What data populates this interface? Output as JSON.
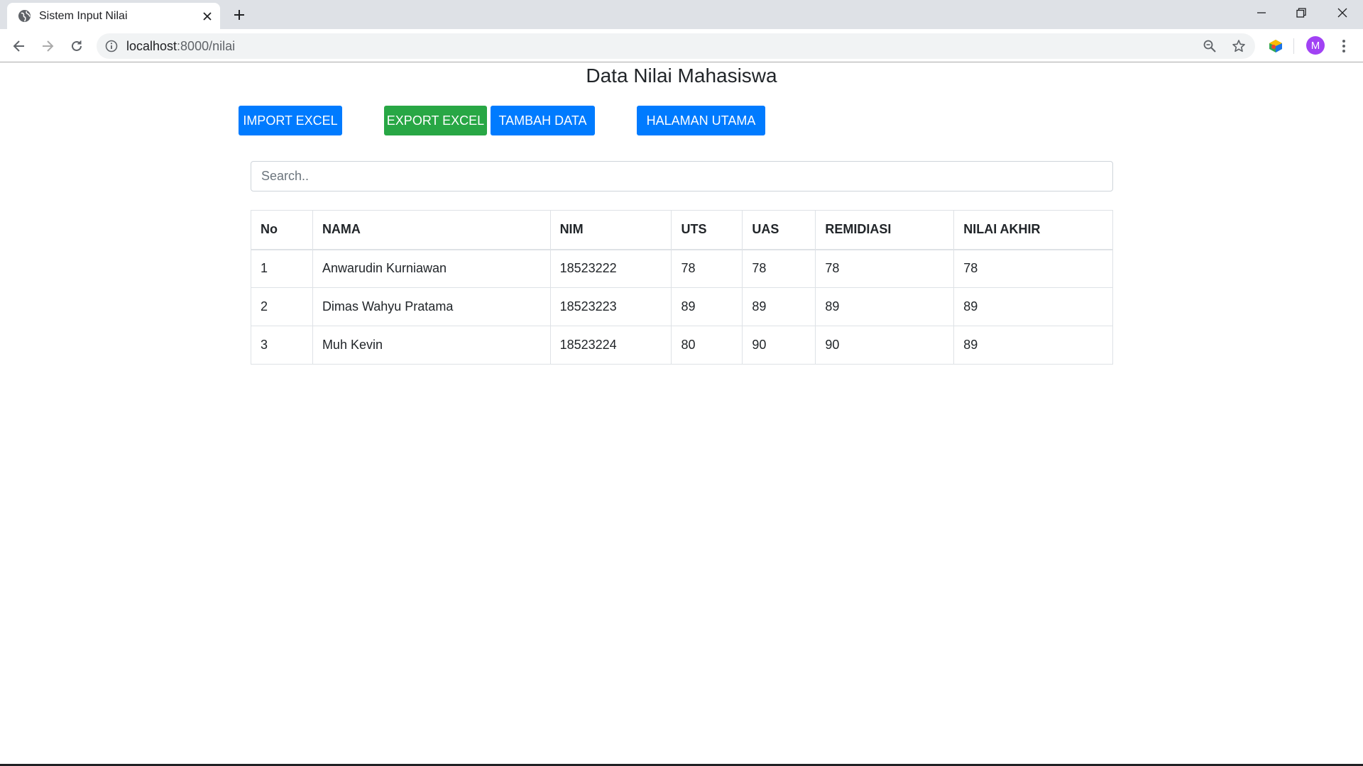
{
  "browser": {
    "tab_title": "Sistem Input Nilai",
    "url_host": "localhost",
    "url_path": ":8000/nilai",
    "profile_initial": "M"
  },
  "page": {
    "title": "Data Nilai Mahasiswa",
    "buttons": {
      "import": "IMPORT EXCEL",
      "export": "EXPORT EXCEL",
      "add": "TAMBAH DATA",
      "home": "HALAMAN UTAMA"
    },
    "search_placeholder": "Search..",
    "table": {
      "headers": [
        "No",
        "NAMA",
        "NIM",
        "UTS",
        "UAS",
        "REMIDIASI",
        "NILAI AKHIR"
      ],
      "rows": [
        [
          "1",
          "Anwarudin Kurniawan",
          "18523222",
          "78",
          "78",
          "78",
          "78"
        ],
        [
          "2",
          "Dimas Wahyu Pratama",
          "18523223",
          "89",
          "89",
          "89",
          "89"
        ],
        [
          "3",
          "Muh Kevin",
          "18523224",
          "80",
          "90",
          "90",
          "89"
        ]
      ]
    }
  },
  "colors": {
    "primary": "#007bff",
    "success": "#28a745",
    "avatar": "#a142f4"
  }
}
